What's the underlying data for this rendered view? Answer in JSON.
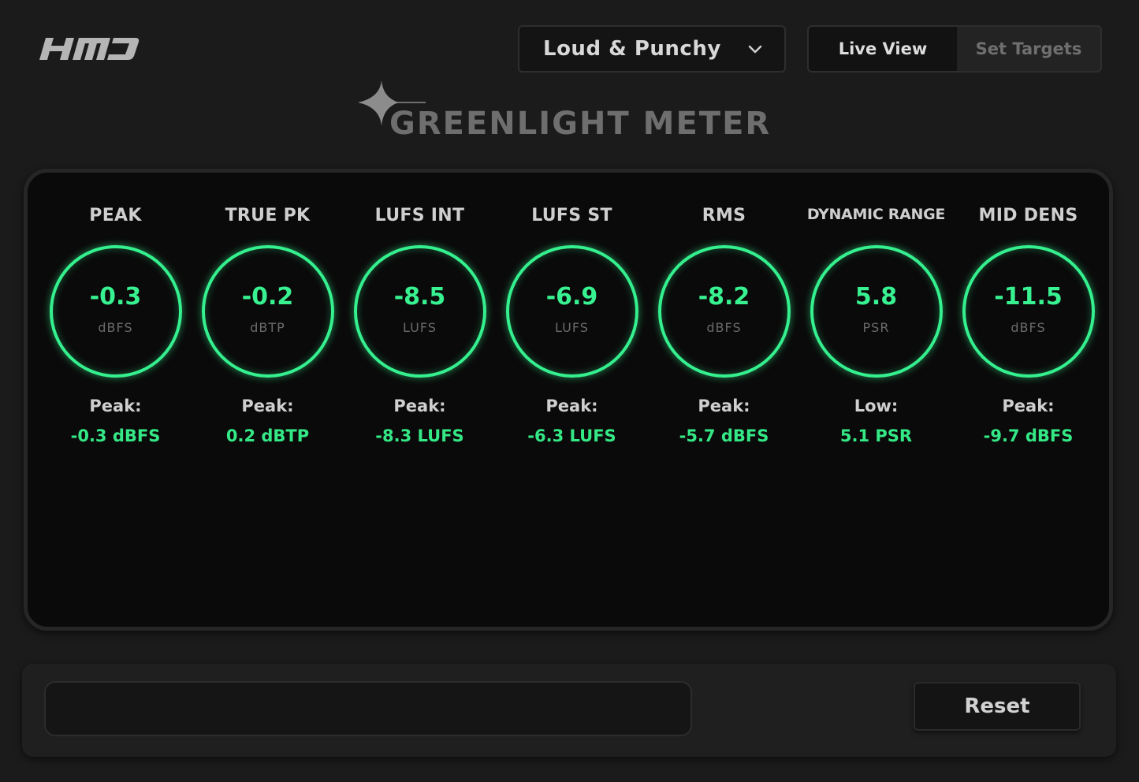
{
  "brand": {
    "logo_text": "HMD"
  },
  "header": {
    "preset": {
      "selected": "Loud & Punchy"
    },
    "view_tabs": [
      {
        "label": "Live View",
        "active": true
      },
      {
        "label": "Set Targets",
        "active": false
      }
    ]
  },
  "title": "GREENLIGHT METER",
  "meters": [
    {
      "label": "PEAK",
      "value": "-0.3",
      "unit": "dBFS",
      "stat_label": "Peak:",
      "stat_value": "-0.3 dBFS"
    },
    {
      "label": "TRUE PK",
      "value": "-0.2",
      "unit": "dBTP",
      "stat_label": "Peak:",
      "stat_value": "0.2 dBTP"
    },
    {
      "label": "LUFS INT",
      "value": "-8.5",
      "unit": "LUFS",
      "stat_label": "Peak:",
      "stat_value": "-8.3 LUFS"
    },
    {
      "label": "LUFS ST",
      "value": "-6.9",
      "unit": "LUFS",
      "stat_label": "Peak:",
      "stat_value": "-6.3 LUFS"
    },
    {
      "label": "RMS",
      "value": "-8.2",
      "unit": "dBFS",
      "stat_label": "Peak:",
      "stat_value": "-5.7 dBFS"
    },
    {
      "label": "DYNAMIC RANGE",
      "value": "5.8",
      "unit": "PSR",
      "stat_label": "Low:",
      "stat_value": "5.1 PSR"
    },
    {
      "label": "MID DENS",
      "value": "-11.5",
      "unit": "dBFS",
      "stat_label": "Peak:",
      "stat_value": "-9.7 dBFS"
    }
  ],
  "footer": {
    "message": "",
    "reset_label": "Reset"
  },
  "colors": {
    "accent_green": "#35f08e",
    "background": "#1b1b1b",
    "panel": "#0a0a0a"
  },
  "icons": {
    "dropdown": "chevron-down-icon",
    "title_decoration": "sparkle-star-icon"
  }
}
